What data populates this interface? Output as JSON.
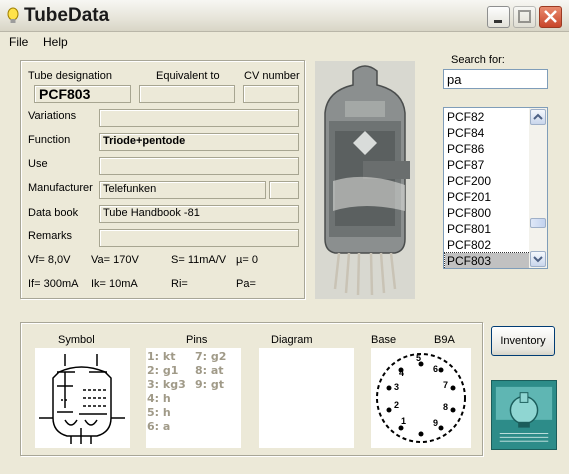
{
  "window": {
    "title": "TubeData"
  },
  "menu": {
    "file": "File",
    "help": "Help"
  },
  "labels": {
    "tube_designation": "Tube designation",
    "equivalent_to": "Equivalent to",
    "cv_number": "CV number",
    "variations": "Variations",
    "function": "Function",
    "use": "Use",
    "manufacturer": "Manufacturer",
    "data_book": "Data book",
    "remarks": "Remarks"
  },
  "fields": {
    "tube_designation": "PCF803",
    "equivalent_to": "",
    "cv_number": "",
    "variations": "",
    "function": "Triode+pentode",
    "use": "",
    "manufacturer": "Telefunken",
    "manufacturer_extra": "",
    "data_book": "Tube Handbook -81",
    "remarks": ""
  },
  "specs": {
    "vf": "Vf= 8,0V",
    "va": "Va= 170V",
    "s": "S= 11mA/V",
    "mu": "µ=    0",
    "if": "If= 300mA",
    "ik": "Ik=  10mA",
    "ri": "Ri=",
    "pa": "Pa="
  },
  "search": {
    "label": "Search for:",
    "value": "pa"
  },
  "list": {
    "items": [
      "PCF82",
      "PCF84",
      "PCF86",
      "PCF87",
      "PCF200",
      "PCF201",
      "PCF800",
      "PCF801",
      "PCF802",
      "PCF803"
    ],
    "selected_index": 9
  },
  "bottom": {
    "symbol_label": "Symbol",
    "pins_label": "Pins",
    "diagram_label": "Diagram",
    "base_label": "Base",
    "base_type": "B9A",
    "pins_col1": [
      "1: kt",
      "2: g1",
      "3: kg3",
      "4: h",
      "5: h",
      "6: a"
    ],
    "pins_col2": [
      "7: g2",
      "8: at",
      "9: gt"
    ],
    "base_pin_numbers": [
      "1",
      "2",
      "3",
      "4",
      "5",
      "6",
      "7",
      "8",
      "9"
    ]
  },
  "inventory_button": "Inventory",
  "colors": {
    "close": "#c8452a",
    "accent": "#316ac5",
    "selection": "#c1c1c1",
    "logo": "#2d8c89"
  },
  "icons": [
    "lightbulb-icon",
    "minimize-icon",
    "maximize-icon",
    "close-icon",
    "scroll-up-icon",
    "scroll-down-icon",
    "tube-symbol-icon",
    "base-pinout-icon",
    "tube-logo-icon"
  ]
}
